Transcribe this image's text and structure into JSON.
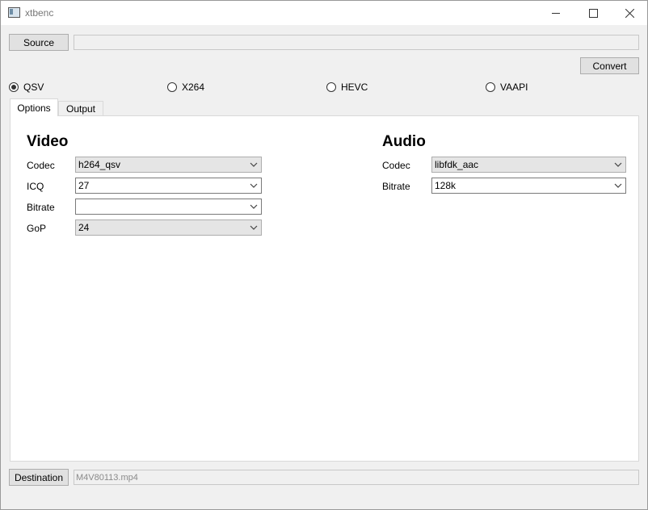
{
  "window": {
    "title": "xtbenc"
  },
  "toolbar": {
    "source_label": "Source",
    "source_path": "",
    "convert_label": "Convert"
  },
  "encoders": [
    {
      "label": "QSV",
      "checked": true
    },
    {
      "label": "X264",
      "checked": false
    },
    {
      "label": "HEVC",
      "checked": false
    },
    {
      "label": "VAAPI",
      "checked": false
    }
  ],
  "tabs": [
    {
      "label": "Options",
      "active": true
    },
    {
      "label": "Output",
      "active": false
    }
  ],
  "video": {
    "heading": "Video",
    "codec_label": "Codec",
    "codec_value": "h264_qsv",
    "icq_label": "ICQ",
    "icq_value": "27",
    "bitrate_label": "Bitrate",
    "bitrate_value": "",
    "gop_label": "GoP",
    "gop_value": "24"
  },
  "audio": {
    "heading": "Audio",
    "codec_label": "Codec",
    "codec_value": "libfdk_aac",
    "bitrate_label": "Bitrate",
    "bitrate_value": "128k"
  },
  "destination": {
    "label": "Destination",
    "path": "M4V80113.mp4"
  },
  "icons": [
    "app-icon",
    "minimize-icon",
    "maximize-icon",
    "close-icon",
    "chevron-down-icon"
  ]
}
